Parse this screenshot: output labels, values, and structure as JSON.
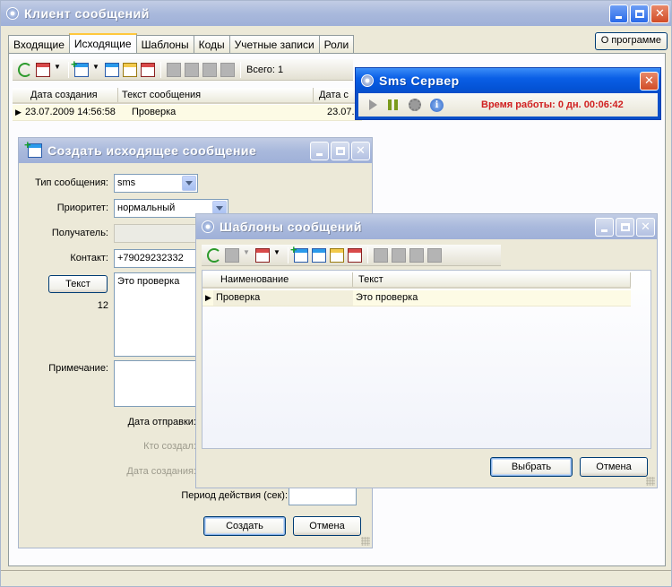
{
  "main_window": {
    "title": "Клиент сообщений",
    "tabs": [
      "Входящие",
      "Исходящие",
      "Шаблоны",
      "Коды",
      "Учетные записи",
      "Роли"
    ],
    "active_tab": "Исходящие",
    "about_label": "О программе",
    "total_label": "Всего: 1",
    "columns": [
      "Дата создания",
      "Текст сообщения",
      "Дата с"
    ],
    "rows": [
      {
        "created": "23.07.2009 14:56:58",
        "text": "Проверка",
        "date": "23.07."
      }
    ]
  },
  "sms_server": {
    "title": "Sms Сервер",
    "uptime": "Время работы: 0 дн. 00:06:42"
  },
  "create_dialog": {
    "title": "Создать исходящее сообщение",
    "type_label": "Тип сообщения:",
    "type_value": "sms",
    "priority_label": "Приоритет:",
    "priority_value": "нормальный",
    "recipient_label": "Получатель:",
    "contact_label": "Контакт:",
    "contact_value": "+79029232332",
    "text_button": "Текст",
    "char_count": "12",
    "message_text": "Это проверка",
    "note_label": "Примечание:",
    "send_date_label": "Дата отправки:",
    "created_by_label": "Кто создал:",
    "created_date_label": "Дата создания:",
    "period_label": "Период действия (сек):",
    "create_button": "Создать",
    "cancel_button": "Отмена"
  },
  "templates_dialog": {
    "title": "Шаблоны сообщений",
    "columns": [
      "Наименование",
      "Текст"
    ],
    "rows": [
      {
        "name": "Проверка",
        "text": "Это проверка"
      }
    ],
    "select_button": "Выбрать",
    "cancel_button": "Отмена"
  }
}
